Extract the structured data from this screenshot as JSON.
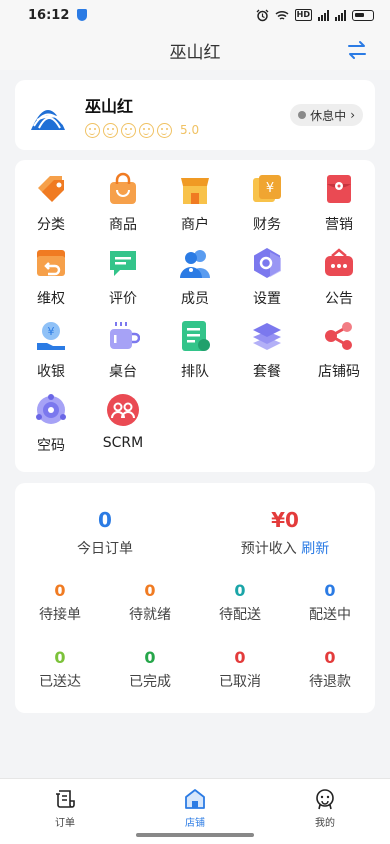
{
  "status": {
    "time": "16:12",
    "network": "HD"
  },
  "header": {
    "title": "巫山红"
  },
  "store": {
    "name": "巫山红",
    "score": "5.0",
    "status_label": "休息中",
    "status_arrow": "›"
  },
  "grid": [
    {
      "label": "分类",
      "icon": "tag-icon"
    },
    {
      "label": "商品",
      "icon": "bag-icon"
    },
    {
      "label": "商户",
      "icon": "shop-icon"
    },
    {
      "label": "财务",
      "icon": "yen-icon"
    },
    {
      "label": "营销",
      "icon": "red-envelope-icon"
    },
    {
      "label": "维权",
      "icon": "return-box-icon"
    },
    {
      "label": "评价",
      "icon": "comment-icon"
    },
    {
      "label": "成员",
      "icon": "members-icon"
    },
    {
      "label": "设置",
      "icon": "hex-settings-icon"
    },
    {
      "label": "公告",
      "icon": "notice-icon"
    },
    {
      "label": "收银",
      "icon": "cashier-icon"
    },
    {
      "label": "桌台",
      "icon": "cup-icon"
    },
    {
      "label": "排队",
      "icon": "queue-icon"
    },
    {
      "label": "套餐",
      "icon": "layers-icon"
    },
    {
      "label": "店铺码",
      "icon": "share-icon"
    },
    {
      "label": "空码",
      "icon": "code-icon"
    },
    {
      "label": "SCRM",
      "icon": "scrm-icon"
    }
  ],
  "stats": {
    "today_orders": {
      "value": "0",
      "label": "今日订单"
    },
    "income": {
      "value": "¥0",
      "label": "预计收入",
      "refresh": "刷新"
    },
    "row1": [
      {
        "value": "0",
        "label": "待接单",
        "color": "#f07b22"
      },
      {
        "value": "0",
        "label": "待就绪",
        "color": "#f07b22"
      },
      {
        "value": "0",
        "label": "待配送",
        "color": "#1aa5a8"
      },
      {
        "value": "0",
        "label": "配送中",
        "color": "#2b7be4"
      }
    ],
    "row2": [
      {
        "value": "0",
        "label": "已送达",
        "color": "#7cc23a"
      },
      {
        "value": "0",
        "label": "已完成",
        "color": "#26a64a"
      },
      {
        "value": "0",
        "label": "已取消",
        "color": "#e33b3b"
      },
      {
        "value": "0",
        "label": "待退款",
        "color": "#e33b3b"
      }
    ]
  },
  "tabs": [
    {
      "label": "订单",
      "icon": "order-icon"
    },
    {
      "label": "店铺",
      "icon": "store-icon",
      "active": true
    },
    {
      "label": "我的",
      "icon": "profile-icon"
    }
  ],
  "colors": {
    "primary": "#2b7be4",
    "income_red": "#e33b3b",
    "star": "#f0c264"
  }
}
